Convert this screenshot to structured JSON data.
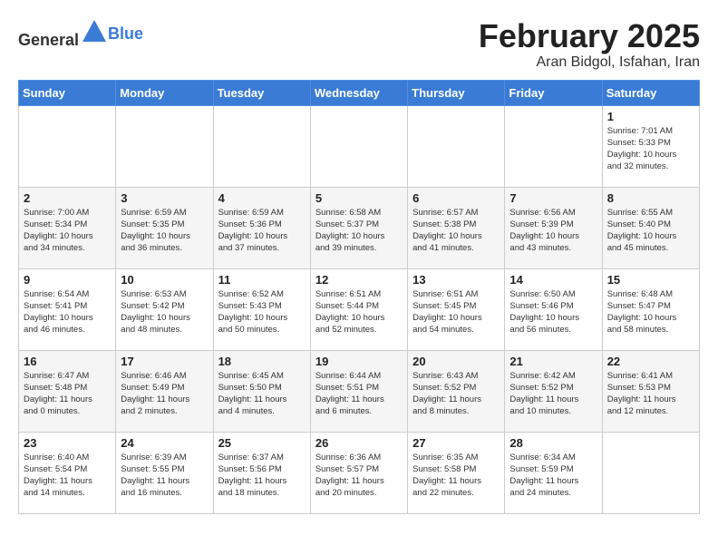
{
  "header": {
    "logo_general": "General",
    "logo_blue": "Blue",
    "month_title": "February 2025",
    "location": "Aran Bidgol, Isfahan, Iran"
  },
  "weekdays": [
    "Sunday",
    "Monday",
    "Tuesday",
    "Wednesday",
    "Thursday",
    "Friday",
    "Saturday"
  ],
  "weeks": [
    [
      {
        "day": "",
        "info": ""
      },
      {
        "day": "",
        "info": ""
      },
      {
        "day": "",
        "info": ""
      },
      {
        "day": "",
        "info": ""
      },
      {
        "day": "",
        "info": ""
      },
      {
        "day": "",
        "info": ""
      },
      {
        "day": "1",
        "info": "Sunrise: 7:01 AM\nSunset: 5:33 PM\nDaylight: 10 hours\nand 32 minutes."
      }
    ],
    [
      {
        "day": "2",
        "info": "Sunrise: 7:00 AM\nSunset: 5:34 PM\nDaylight: 10 hours\nand 34 minutes."
      },
      {
        "day": "3",
        "info": "Sunrise: 6:59 AM\nSunset: 5:35 PM\nDaylight: 10 hours\nand 36 minutes."
      },
      {
        "day": "4",
        "info": "Sunrise: 6:59 AM\nSunset: 5:36 PM\nDaylight: 10 hours\nand 37 minutes."
      },
      {
        "day": "5",
        "info": "Sunrise: 6:58 AM\nSunset: 5:37 PM\nDaylight: 10 hours\nand 39 minutes."
      },
      {
        "day": "6",
        "info": "Sunrise: 6:57 AM\nSunset: 5:38 PM\nDaylight: 10 hours\nand 41 minutes."
      },
      {
        "day": "7",
        "info": "Sunrise: 6:56 AM\nSunset: 5:39 PM\nDaylight: 10 hours\nand 43 minutes."
      },
      {
        "day": "8",
        "info": "Sunrise: 6:55 AM\nSunset: 5:40 PM\nDaylight: 10 hours\nand 45 minutes."
      }
    ],
    [
      {
        "day": "9",
        "info": "Sunrise: 6:54 AM\nSunset: 5:41 PM\nDaylight: 10 hours\nand 46 minutes."
      },
      {
        "day": "10",
        "info": "Sunrise: 6:53 AM\nSunset: 5:42 PM\nDaylight: 10 hours\nand 48 minutes."
      },
      {
        "day": "11",
        "info": "Sunrise: 6:52 AM\nSunset: 5:43 PM\nDaylight: 10 hours\nand 50 minutes."
      },
      {
        "day": "12",
        "info": "Sunrise: 6:51 AM\nSunset: 5:44 PM\nDaylight: 10 hours\nand 52 minutes."
      },
      {
        "day": "13",
        "info": "Sunrise: 6:51 AM\nSunset: 5:45 PM\nDaylight: 10 hours\nand 54 minutes."
      },
      {
        "day": "14",
        "info": "Sunrise: 6:50 AM\nSunset: 5:46 PM\nDaylight: 10 hours\nand 56 minutes."
      },
      {
        "day": "15",
        "info": "Sunrise: 6:48 AM\nSunset: 5:47 PM\nDaylight: 10 hours\nand 58 minutes."
      }
    ],
    [
      {
        "day": "16",
        "info": "Sunrise: 6:47 AM\nSunset: 5:48 PM\nDaylight: 11 hours\nand 0 minutes."
      },
      {
        "day": "17",
        "info": "Sunrise: 6:46 AM\nSunset: 5:49 PM\nDaylight: 11 hours\nand 2 minutes."
      },
      {
        "day": "18",
        "info": "Sunrise: 6:45 AM\nSunset: 5:50 PM\nDaylight: 11 hours\nand 4 minutes."
      },
      {
        "day": "19",
        "info": "Sunrise: 6:44 AM\nSunset: 5:51 PM\nDaylight: 11 hours\nand 6 minutes."
      },
      {
        "day": "20",
        "info": "Sunrise: 6:43 AM\nSunset: 5:52 PM\nDaylight: 11 hours\nand 8 minutes."
      },
      {
        "day": "21",
        "info": "Sunrise: 6:42 AM\nSunset: 5:52 PM\nDaylight: 11 hours\nand 10 minutes."
      },
      {
        "day": "22",
        "info": "Sunrise: 6:41 AM\nSunset: 5:53 PM\nDaylight: 11 hours\nand 12 minutes."
      }
    ],
    [
      {
        "day": "23",
        "info": "Sunrise: 6:40 AM\nSunset: 5:54 PM\nDaylight: 11 hours\nand 14 minutes."
      },
      {
        "day": "24",
        "info": "Sunrise: 6:39 AM\nSunset: 5:55 PM\nDaylight: 11 hours\nand 16 minutes."
      },
      {
        "day": "25",
        "info": "Sunrise: 6:37 AM\nSunset: 5:56 PM\nDaylight: 11 hours\nand 18 minutes."
      },
      {
        "day": "26",
        "info": "Sunrise: 6:36 AM\nSunset: 5:57 PM\nDaylight: 11 hours\nand 20 minutes."
      },
      {
        "day": "27",
        "info": "Sunrise: 6:35 AM\nSunset: 5:58 PM\nDaylight: 11 hours\nand 22 minutes."
      },
      {
        "day": "28",
        "info": "Sunrise: 6:34 AM\nSunset: 5:59 PM\nDaylight: 11 hours\nand 24 minutes."
      },
      {
        "day": "",
        "info": ""
      }
    ]
  ]
}
